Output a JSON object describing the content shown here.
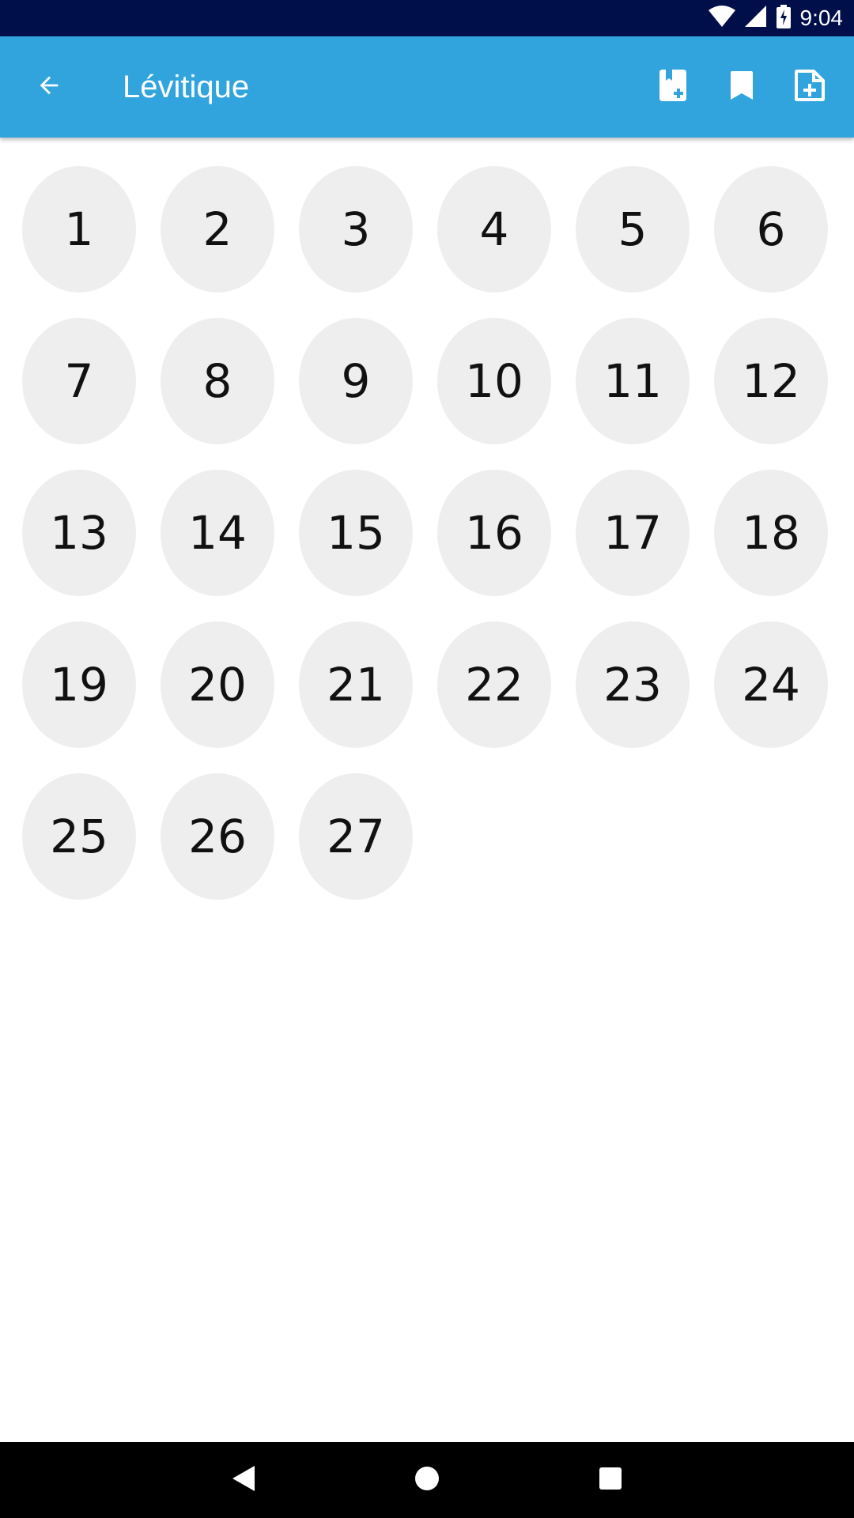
{
  "status_bar": {
    "time": "9:04",
    "icons": [
      "wifi-icon",
      "cell-signal-icon",
      "battery-charging-icon"
    ]
  },
  "app_bar": {
    "title": "Lévitique",
    "background_color": "#31a4dd",
    "nav_icon": "arrow-back-icon",
    "actions": [
      "book-add-icon",
      "bookmark-icon",
      "note-add-icon"
    ]
  },
  "chapters": [
    "1",
    "2",
    "3",
    "4",
    "5",
    "6",
    "7",
    "8",
    "9",
    "10",
    "11",
    "12",
    "13",
    "14",
    "15",
    "16",
    "17",
    "18",
    "19",
    "20",
    "21",
    "22",
    "23",
    "24",
    "25",
    "26",
    "27"
  ],
  "chapter_bubble_color": "#eeeeee",
  "nav_bar": {
    "buttons": [
      "back-triangle-icon",
      "home-circle-icon",
      "recents-square-icon"
    ]
  }
}
